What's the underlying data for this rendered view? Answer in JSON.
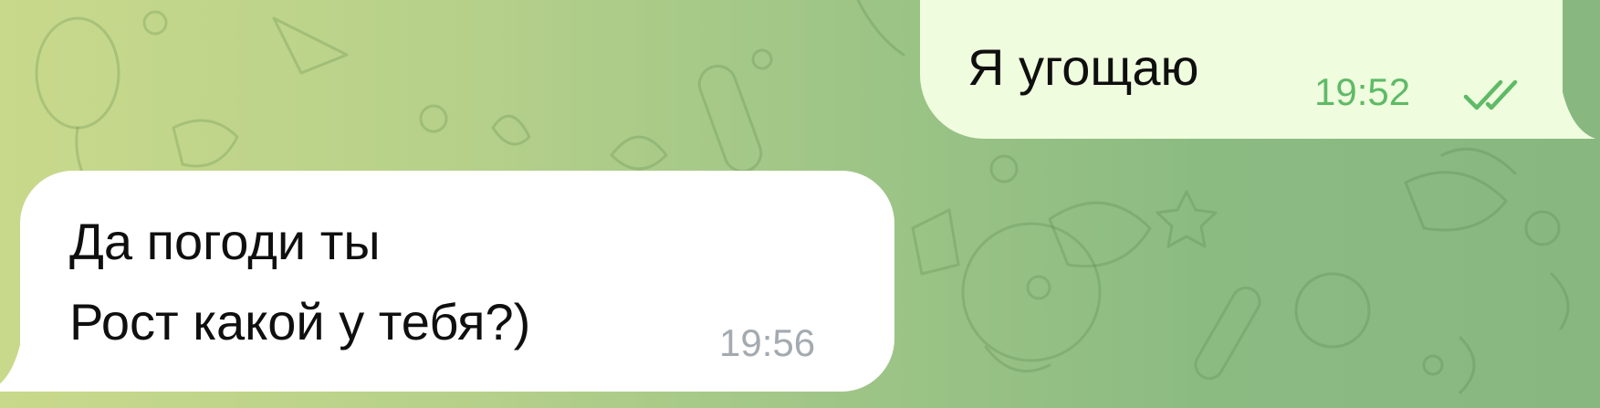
{
  "chat": {
    "messages": [
      {
        "direction": "outgoing",
        "lines": [
          "Я угощаю"
        ],
        "time": "19:52",
        "status_icon": "double-check-icon"
      },
      {
        "direction": "incoming",
        "lines": [
          "Да погоди ты",
          "Рост какой у тебя?)"
        ],
        "time": "19:56"
      }
    ]
  },
  "colors": {
    "outgoing_bubble": "#effdde",
    "incoming_bubble": "#ffffff",
    "outgoing_time": "#5fba67",
    "incoming_time": "#a3aab0",
    "background_left": "#c9d98b",
    "background_right": "#88b880"
  }
}
